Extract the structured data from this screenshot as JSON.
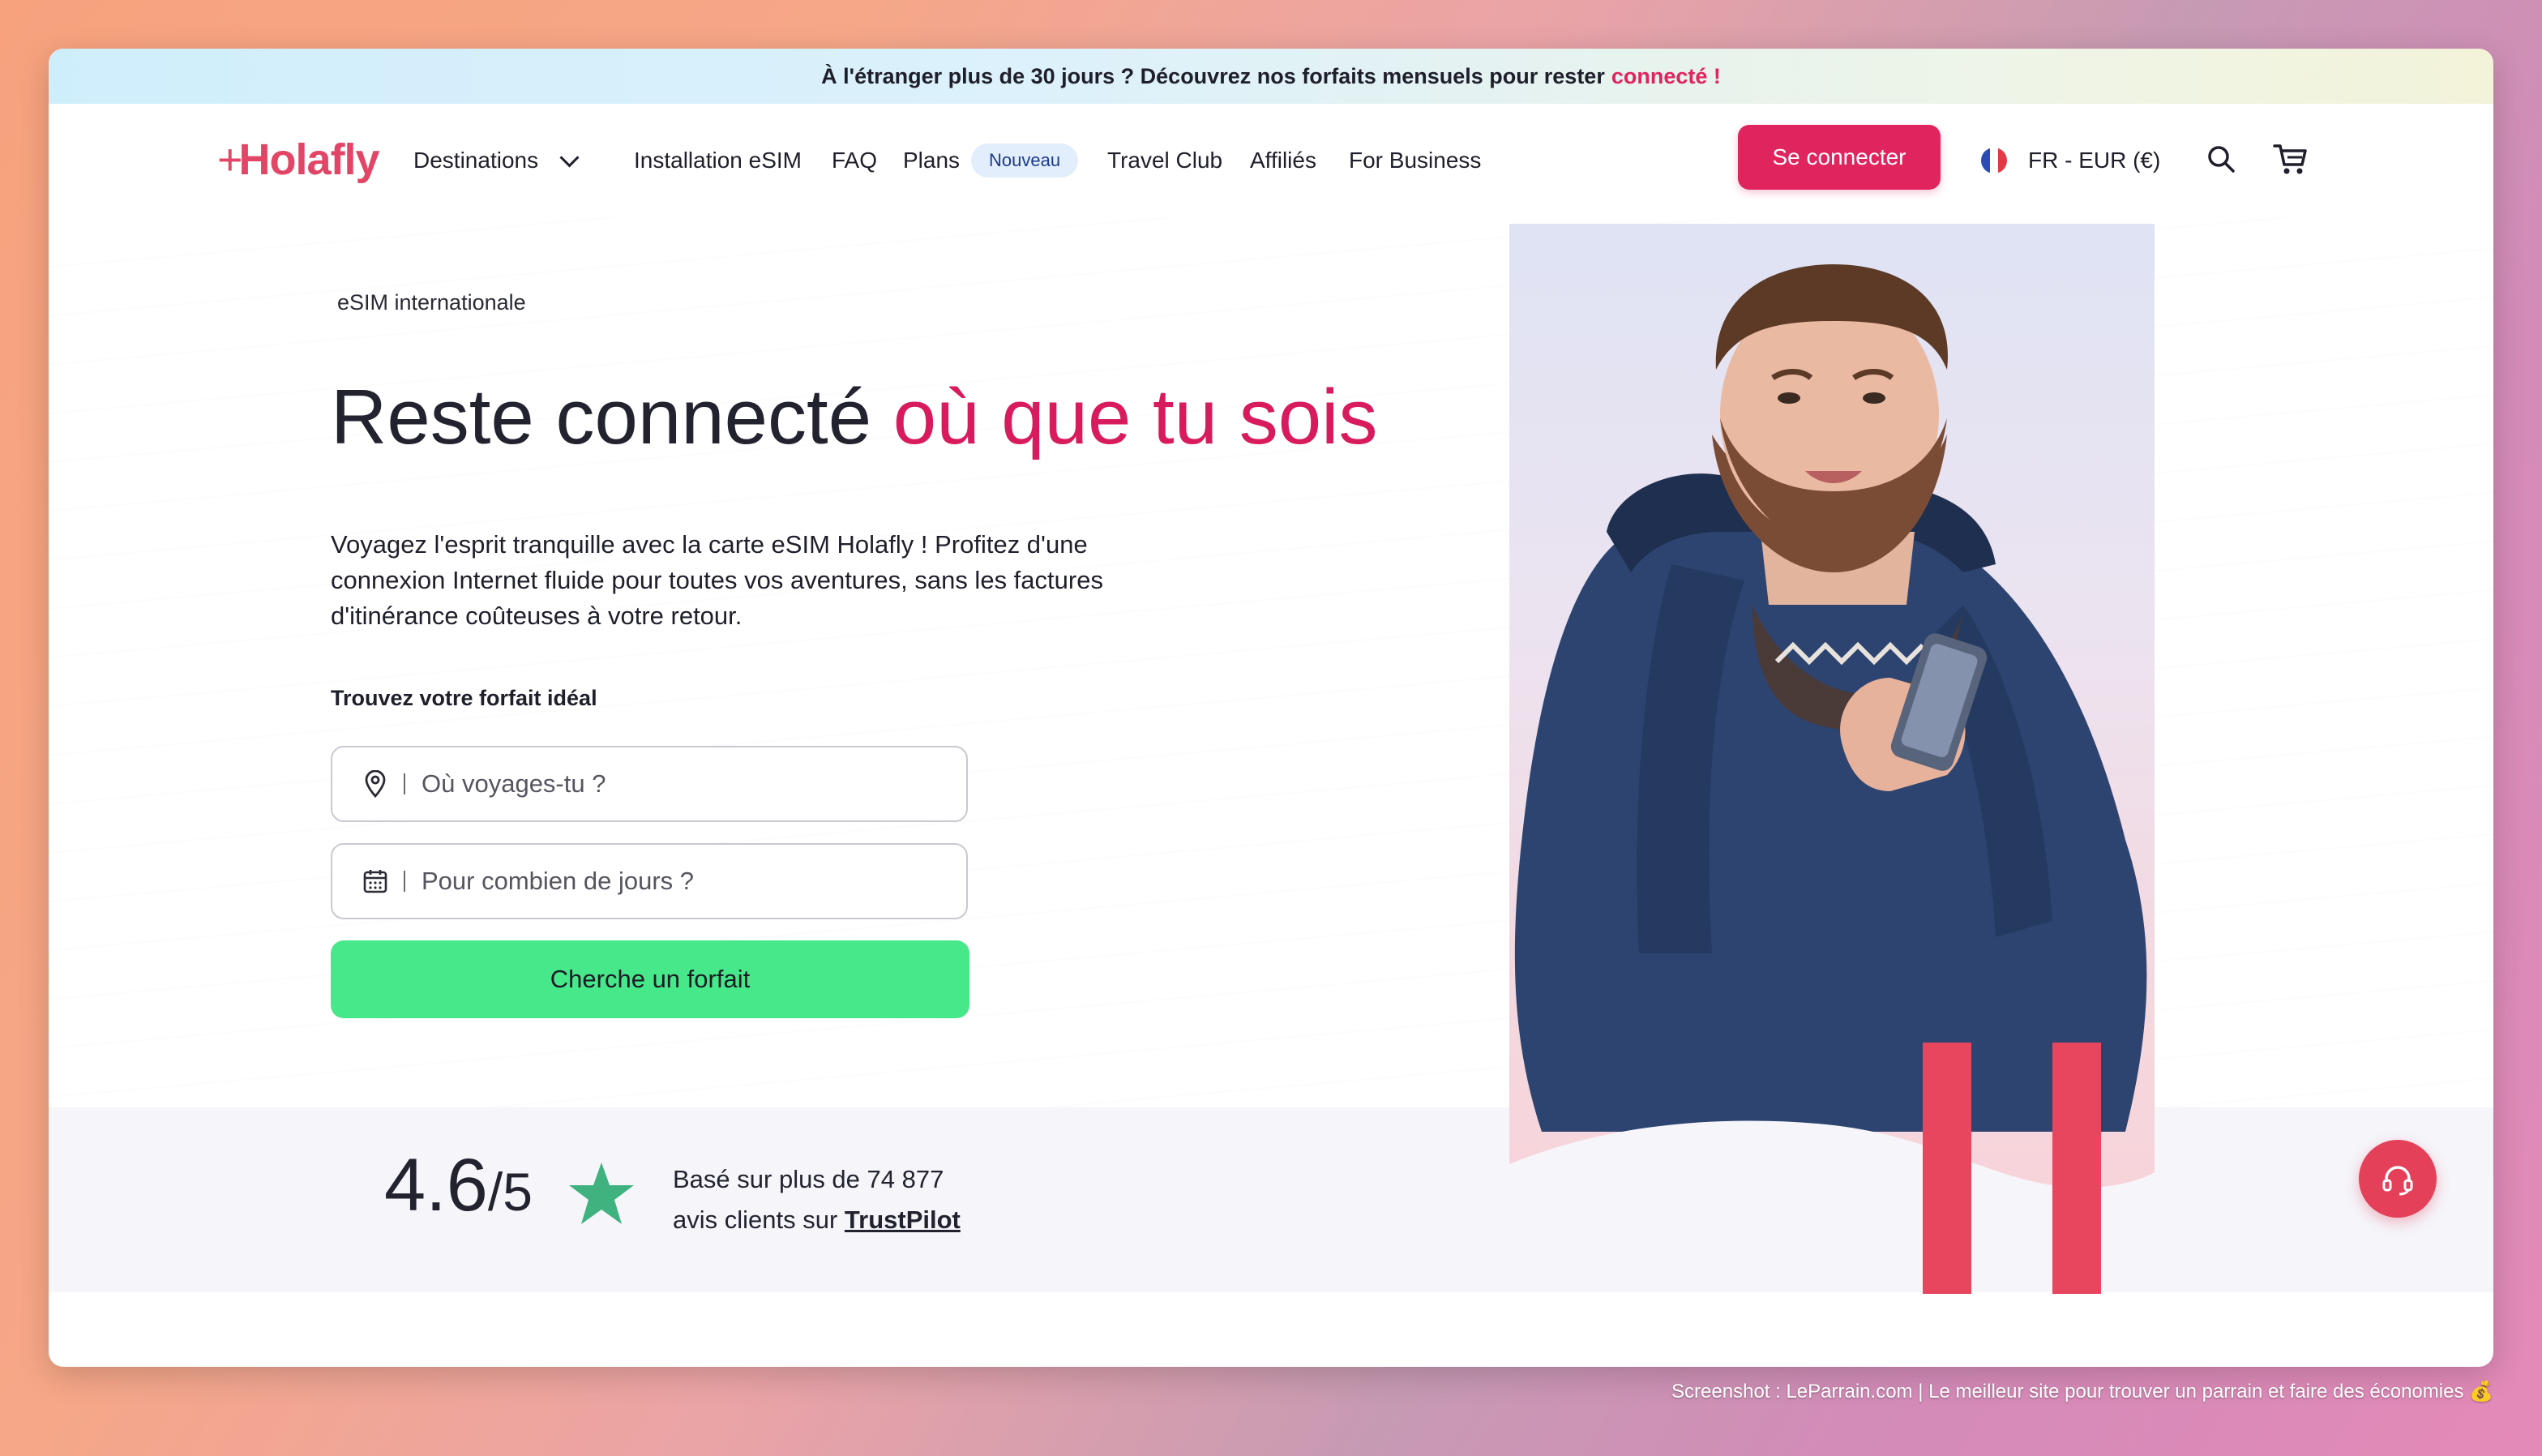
{
  "promo": {
    "text": "À l'étranger plus de 30 jours ? Découvrez nos forfaits mensuels pour rester",
    "highlight": "connecté !"
  },
  "nav": {
    "logo": "Holafly",
    "items": [
      {
        "label": "Destinations"
      },
      {
        "label": "Installation eSIM"
      },
      {
        "label": "FAQ"
      },
      {
        "label": "Plans",
        "badge": "Nouveau"
      },
      {
        "label": "Travel Club"
      },
      {
        "label": "Affiliés"
      },
      {
        "label": "For Business"
      }
    ],
    "login": "Se connecter",
    "locale": "FR - EUR (€)",
    "icons": [
      "search-icon",
      "cart-icon",
      "france-flag-icon"
    ]
  },
  "hero": {
    "eyebrow": "eSIM internationale",
    "title_main": "Reste connecté",
    "title_accent": "où que tu sois",
    "lead": "Voyagez l'esprit tranquille avec la carte eSIM Holafly ! Profitez d'une connexion Internet fluide pour toutes vos aventures, sans les factures d'itinérance coûteuses à votre retour.",
    "find_label": "Trouvez votre forfait idéal",
    "destination_placeholder": "Où voyages-tu ?",
    "days_placeholder": "Pour combien de jours ?",
    "search_button": "Cherche un forfait"
  },
  "rating": {
    "score": "4.6",
    "out_of": "/5",
    "line1": "Basé sur plus de 74 877",
    "line2": "avis clients sur",
    "source": "TrustPilot"
  },
  "watermark": "Screenshot : LeParrain.com | Le meilleur site pour trouver un parrain et faire des économies 💰",
  "colors": {
    "brand": "#e0245e",
    "cta_green": "#47e88a",
    "star_green": "#3fb27f"
  }
}
